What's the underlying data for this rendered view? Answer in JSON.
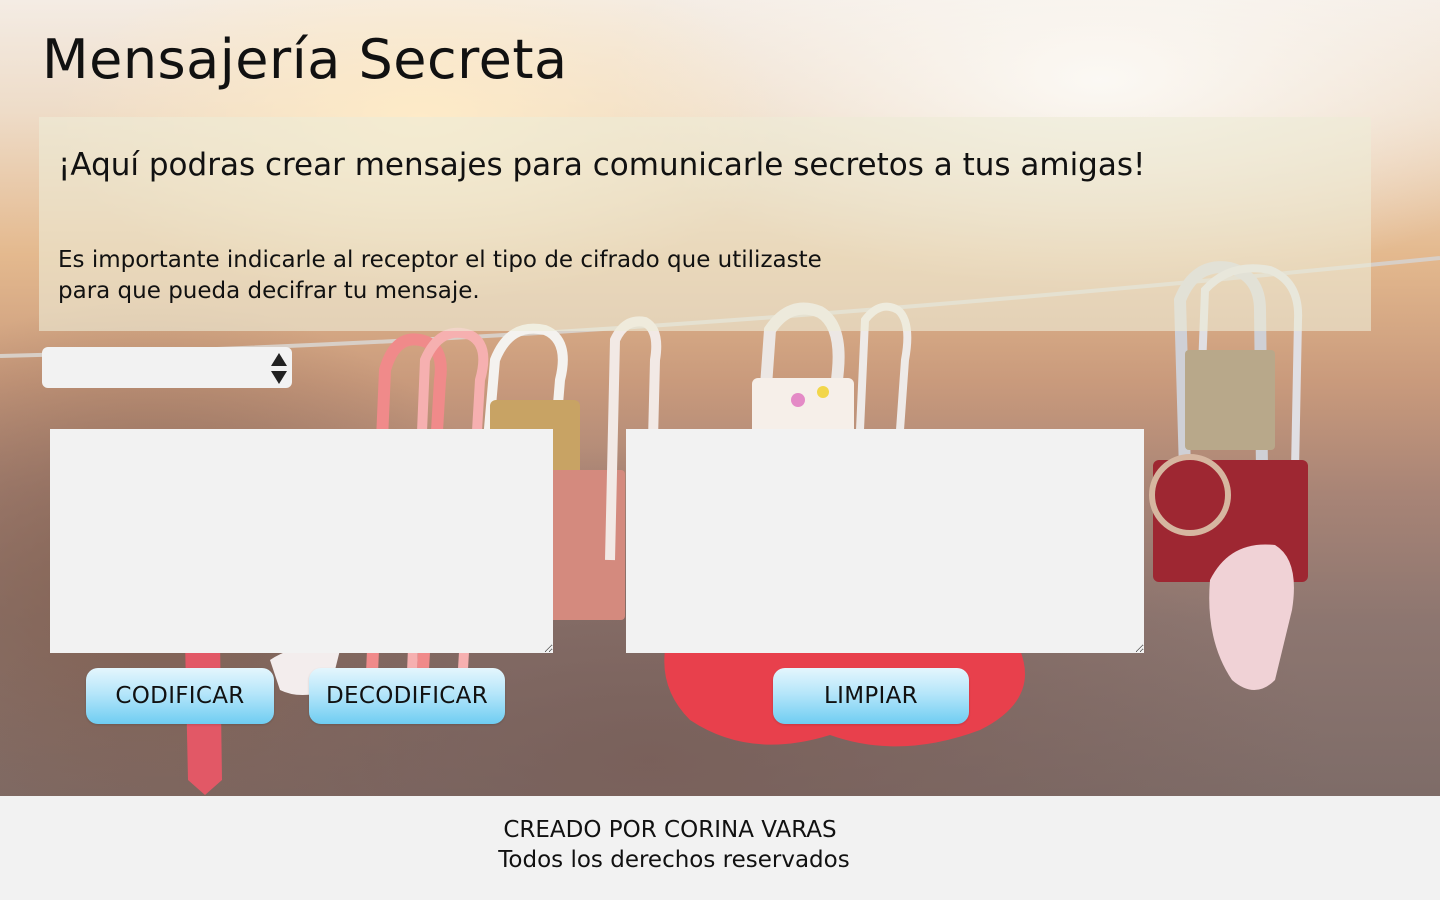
{
  "header": {
    "title": "Mensajería Secreta"
  },
  "intro": {
    "lead": "¡Aquí podras crear mensajes para comunicarle secretos a tus amigas!",
    "note_line1": "Es importante indicarle al receptor el tipo de cifrado que utilizaste",
    "note_line2": "para que pueda decifrar tu mensaje."
  },
  "cipher_select": {
    "selected": ""
  },
  "input_text": {
    "value": "",
    "placeholder": ""
  },
  "output_text": {
    "value": "",
    "placeholder": ""
  },
  "buttons": {
    "encode": "CODIFICAR",
    "decode": "DECODIFICAR",
    "clear": "LIMPIAR"
  },
  "footer": {
    "credit": "CREADO POR CORINA VARAS",
    "rights": "Todos los derechos reservados"
  },
  "colors": {
    "button_top": "#e4f6fd",
    "button_bottom": "#6fcdf2",
    "field_background": "#f2f2f2",
    "footer_background": "#f2f2f2"
  }
}
